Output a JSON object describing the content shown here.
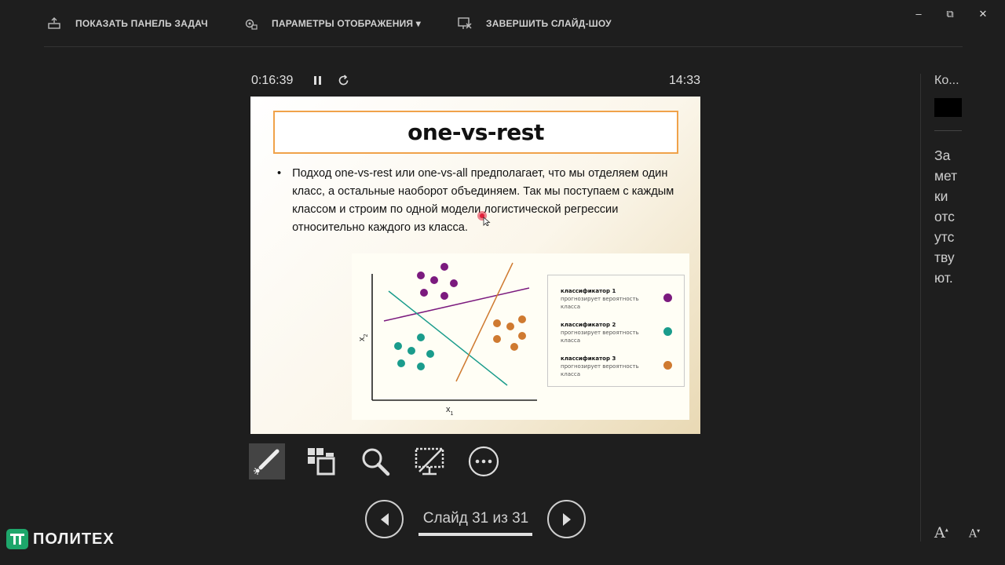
{
  "toolbar": {
    "show_taskbar": "ПОКАЗАТЬ ПАНЕЛЬ ЗАДАЧ",
    "display_settings": "ПАРАМЕТРЫ ОТОБРАЖЕНИЯ ▾",
    "end_slideshow": "ЗАВЕРШИТЬ СЛАЙД-ШОУ"
  },
  "window": {
    "minimize": "–",
    "restore": "⧉",
    "close": "✕"
  },
  "presenter": {
    "elapsed": "0:16:39",
    "clock": "14:33"
  },
  "slide": {
    "title": "one-vs-rest",
    "bullet": "Подход one-vs-rest или one-vs-all предполагает, что мы отделяем один класс, а остальные наоборот объединяем. Так мы поступаем с каждым классом и строим по одной модели логистической регрессии относительно каждого из класса.",
    "diagram": {
      "x_axis": "x",
      "x_sub": "1",
      "y_axis": "x",
      "y_sub": "2",
      "legend": [
        {
          "title": "классификатор 1",
          "desc": "прогнозирует вероятность класса",
          "color": "#7b1a7e"
        },
        {
          "title": "классификатор 2",
          "desc": "прогнозирует вероятность класса",
          "color": "#1a9c8c"
        },
        {
          "title": "классификатор 3",
          "desc": "прогнозирует вероятность класса",
          "color": "#cf7a30"
        }
      ]
    }
  },
  "navigation": {
    "counter": "Слайд 31 из 31",
    "progress": 1.0
  },
  "notes_panel": {
    "label": "Ко...",
    "notes": "Заметки отсутствуют."
  },
  "font_controls": {
    "increase": "A",
    "decrease": "A"
  },
  "logo": {
    "text": "ПОЛИТЕХ"
  }
}
